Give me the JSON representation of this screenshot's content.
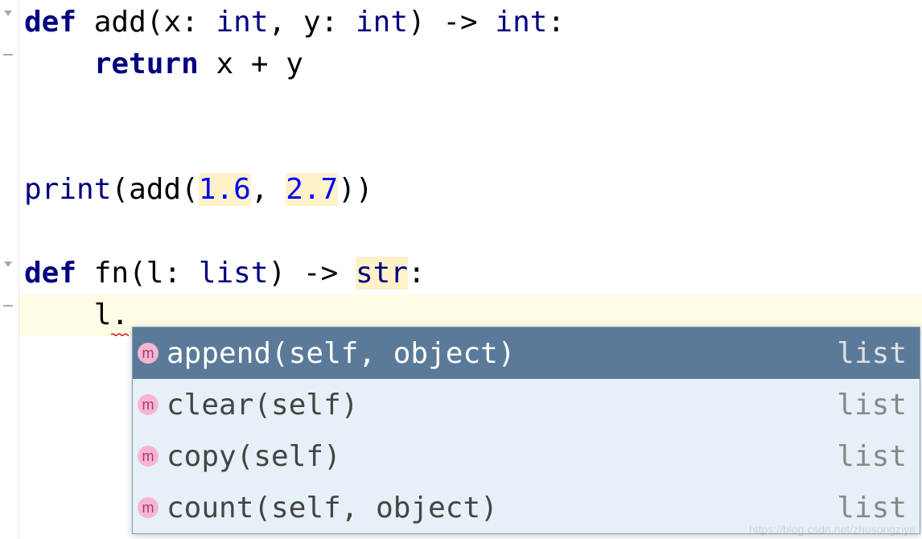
{
  "code": {
    "line1": {
      "def": "def",
      "fn": "add",
      "p1": "x",
      "t1": "int",
      "p2": "y",
      "t2": "int",
      "arrow": "->",
      "ret": "int"
    },
    "line2": {
      "return": "return",
      "expr_a": "x",
      "op": "+",
      "expr_b": "y"
    },
    "line5": {
      "print": "print",
      "call": "add",
      "arg1": "1.6",
      "arg2": "2.7"
    },
    "line7": {
      "def": "def",
      "fn": "fn",
      "p1": "l",
      "t1": "list",
      "arrow": "->",
      "ret": "str"
    },
    "line8": {
      "var": "l",
      "dot": "."
    }
  },
  "completion": {
    "items": [
      {
        "icon": "m",
        "label": "append(self, object)",
        "type": "list"
      },
      {
        "icon": "m",
        "label": "clear(self)",
        "type": "list"
      },
      {
        "icon": "m",
        "label": "copy(self)",
        "type": "list"
      },
      {
        "icon": "m",
        "label": "count(self, object)",
        "type": "list"
      }
    ]
  },
  "watermark": "https://blog.csdn.net/zhusongziye"
}
